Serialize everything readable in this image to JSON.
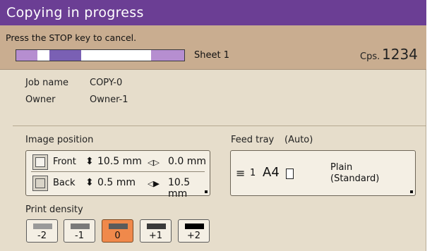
{
  "title": "Copying in progress",
  "status": {
    "message": "Press the STOP key to cancel.",
    "progress_segments": [
      {
        "color": "#b68ed0"
      },
      {
        "color": "#ffffff"
      },
      {
        "color": "#7a60b4"
      },
      {
        "color": "#ffffff"
      },
      {
        "color": "#ffffff"
      },
      {
        "color": "#ffffff"
      },
      {
        "color": "#ffffff"
      },
      {
        "color": "#b68ed0"
      }
    ],
    "sheet": "Sheet 1",
    "cps_label": "Cps.",
    "cps_value": "1234"
  },
  "job": {
    "name_label": "Job name",
    "name_value": "COPY-0",
    "owner_label": "Owner",
    "owner_value": "Owner-1"
  },
  "image_position": {
    "label": "Image position",
    "front": {
      "label": "Front",
      "vertical": "10.5 mm",
      "horizontal": "0.0 mm"
    },
    "back": {
      "label": "Back",
      "vertical": "0.5 mm",
      "horizontal": "10.5 mm"
    }
  },
  "feed_tray": {
    "label": "Feed tray",
    "mode": "(Auto)",
    "tray_number": "1",
    "paper_size": "A4",
    "paper_type_line1": "Plain",
    "paper_type_line2": "(Standard)"
  },
  "print_density": {
    "label": "Print density",
    "options": [
      {
        "label": "-2",
        "color": "#9a9a9a",
        "selected": false
      },
      {
        "label": "-1",
        "color": "#7a7a7a",
        "selected": false
      },
      {
        "label": "0",
        "color": "#5b5b5b",
        "selected": true
      },
      {
        "label": "+1",
        "color": "#3a3a3a",
        "selected": false
      },
      {
        "label": "+2",
        "color": "#000000",
        "selected": false
      }
    ]
  },
  "colors": {
    "title_bg": "#6b3e94",
    "status_bg": "#c9ad90",
    "panel_bg": "#e6ddcb",
    "selected": "#f0894b"
  }
}
